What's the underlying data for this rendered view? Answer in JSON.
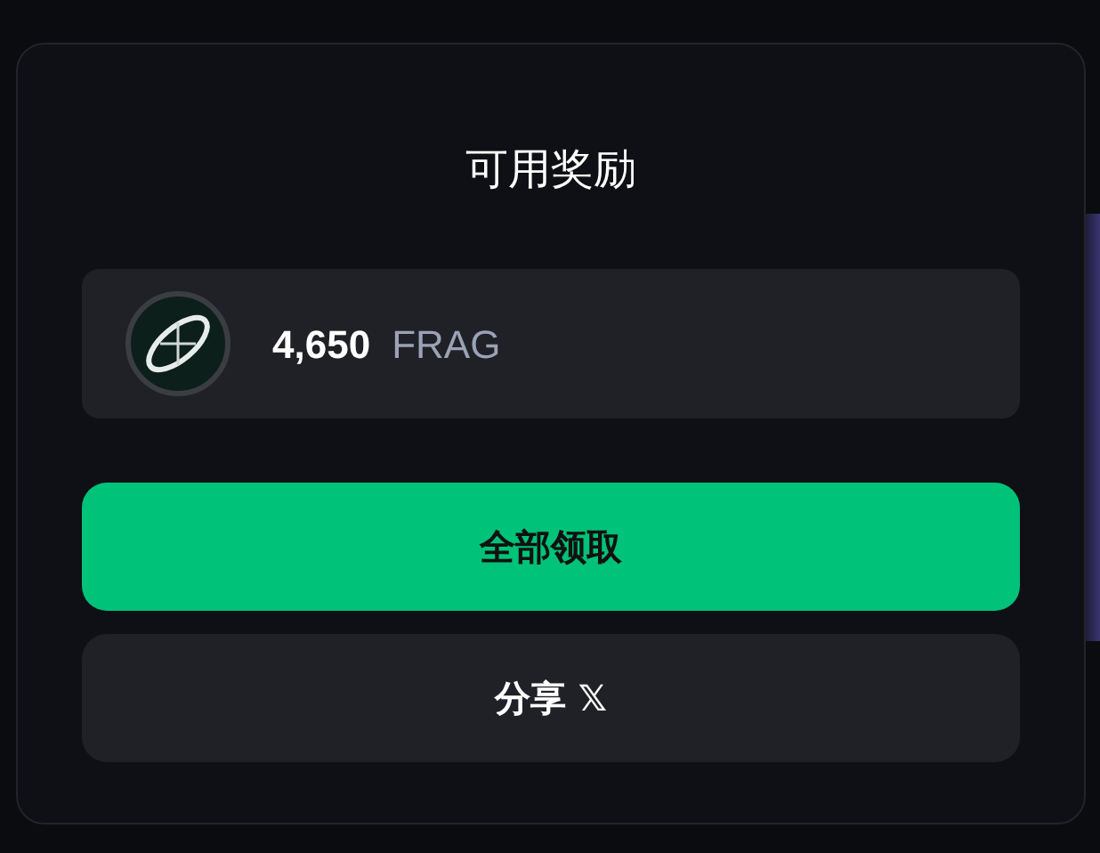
{
  "title": "可用奖励",
  "reward": {
    "amount": "4,650",
    "token": "FRAG"
  },
  "buttons": [
    {
      "kind": "primary",
      "label": "全部领取"
    },
    {
      "kind": "secondary",
      "label": "分享",
      "icon_text": "𝕏"
    }
  ]
}
